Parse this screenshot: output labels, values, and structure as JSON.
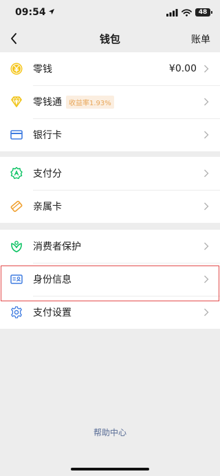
{
  "status_bar": {
    "time": "09:54",
    "battery": "48"
  },
  "nav": {
    "title": "钱包",
    "right_label": "账单"
  },
  "groups": [
    {
      "items": [
        {
          "icon": "yen-coin-icon",
          "label": "零钱",
          "value": "¥0.00"
        },
        {
          "icon": "diamond-icon",
          "label": "零钱通",
          "badge": "收益率1.93%"
        },
        {
          "icon": "bank-card-icon",
          "label": "银行卡"
        }
      ]
    },
    {
      "items": [
        {
          "icon": "payment-score-icon",
          "label": "支付分"
        },
        {
          "icon": "family-card-icon",
          "label": "亲属卡"
        }
      ]
    },
    {
      "items": [
        {
          "icon": "consumer-protection-icon",
          "label": "消费者保护"
        },
        {
          "icon": "id-card-icon",
          "label": "身份信息"
        },
        {
          "icon": "settings-gear-icon",
          "label": "支付设置"
        }
      ]
    }
  ],
  "help": {
    "label": "帮助中心"
  },
  "colors": {
    "accent_green": "#07c160",
    "highlight_red": "#e34a4a",
    "link_blue": "#576b95",
    "gold": "#f0c419",
    "orange": "#f0a030"
  }
}
